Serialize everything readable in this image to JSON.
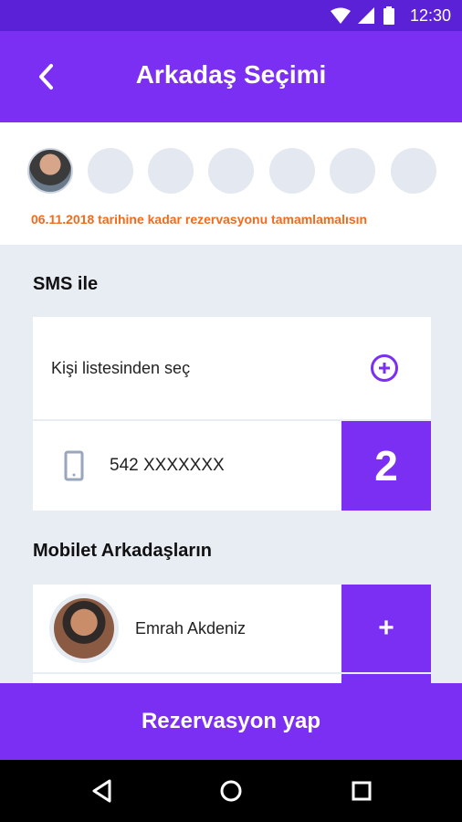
{
  "status": {
    "time": "12:30"
  },
  "header": {
    "title": "Arkadaş Seçimi"
  },
  "deadline_text": "06.11.2018 tarihine kadar rezervasyonu tamamlamalısın",
  "sms": {
    "section_title": "SMS ile",
    "pick_from_contacts": "Kişi listesinden seç",
    "phone_number": "542 XXXXXXX",
    "count": "2"
  },
  "friends": {
    "section_title": "Mobilet Arkadaşların",
    "items": [
      {
        "name": "Emrah Akdeniz",
        "add_label": "+"
      }
    ]
  },
  "cta": {
    "label": "Rezervasyon yap"
  }
}
